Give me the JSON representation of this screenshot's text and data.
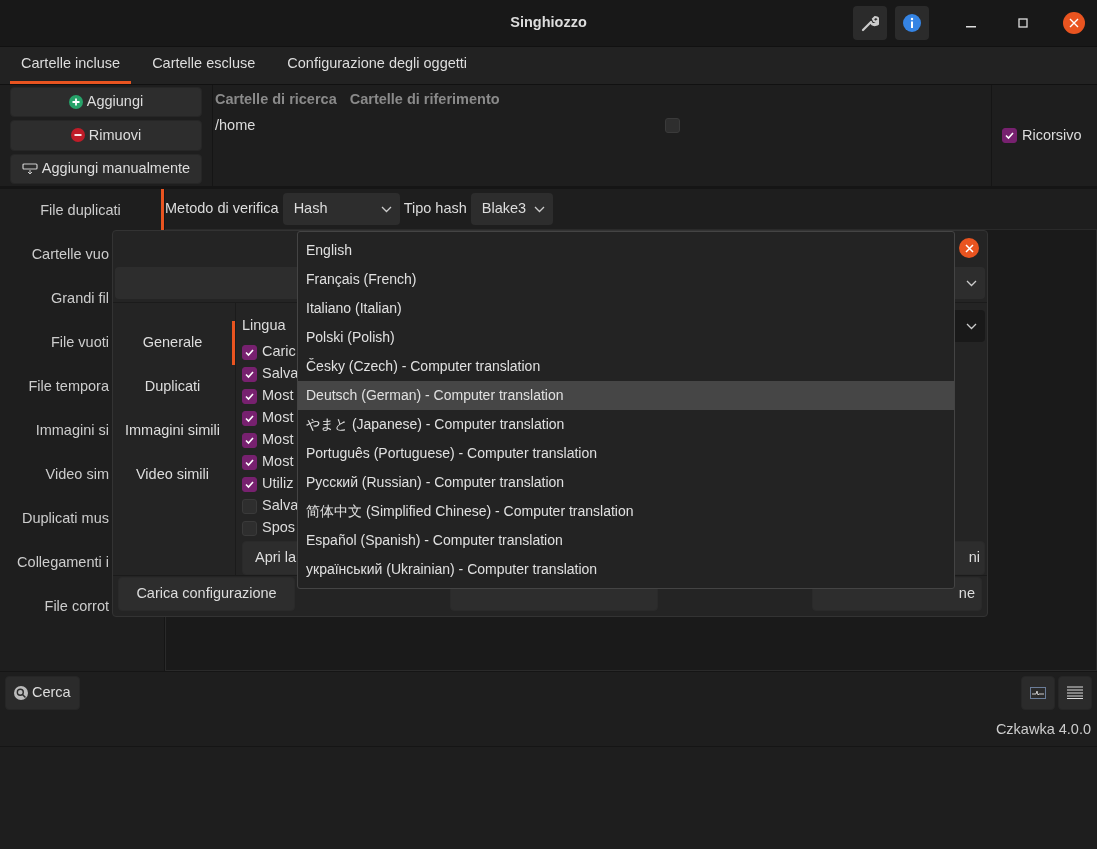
{
  "window": {
    "title": "Singhiozzo"
  },
  "tabs": [
    {
      "label": "Cartelle incluse",
      "selected": true
    },
    {
      "label": "Cartelle escluse",
      "selected": false
    },
    {
      "label": "Configurazione degli oggetti",
      "selected": false
    }
  ],
  "folder_buttons": [
    {
      "label": "Aggiungi",
      "kind": "add"
    },
    {
      "label": "Rimuovi",
      "kind": "remove"
    },
    {
      "label": "Aggiungi manualmente",
      "kind": "manual"
    }
  ],
  "folders_table": {
    "columns": [
      "Cartelle di ricerca",
      "Cartelle di riferimento"
    ],
    "rows": [
      {
        "path": "/home",
        "reference": false
      }
    ]
  },
  "recursive": {
    "label": "Ricorsivo",
    "checked": true
  },
  "verify": {
    "method_label": "Metodo di verifica",
    "method": "Hash",
    "hash_label": "Tipo hash",
    "hash": "Blake3"
  },
  "sidebar": {
    "items": [
      {
        "label": "File duplicati",
        "selected": true
      },
      {
        "label": "Cartelle vuo",
        "selected": false
      },
      {
        "label": "Grandi fil",
        "selected": false
      },
      {
        "label": "File vuoti",
        "selected": false
      },
      {
        "label": "File tempora",
        "selected": false
      },
      {
        "label": "Immagini si",
        "selected": false
      },
      {
        "label": "Video sim",
        "selected": false
      },
      {
        "label": "Duplicati mus",
        "selected": false
      },
      {
        "label": "Collegamenti i",
        "selected": false
      },
      {
        "label": "File corrot",
        "selected": false
      }
    ]
  },
  "search_button": "Cerca",
  "version": "Czkawka 4.0.0",
  "settings_dialog": {
    "tabs": [
      {
        "label": "Generale",
        "selected": true
      },
      {
        "label": "Duplicati",
        "selected": false
      },
      {
        "label": "Immagini simili",
        "selected": false
      },
      {
        "label": "Video simili",
        "selected": false
      }
    ],
    "language_label": "Lingua",
    "options": [
      {
        "label": "Caric",
        "checked": true
      },
      {
        "label": "Salva",
        "checked": true
      },
      {
        "label": "Most",
        "checked": true
      },
      {
        "label": "Most",
        "checked": true
      },
      {
        "label": "Most",
        "checked": true
      },
      {
        "label": "Most",
        "checked": true
      },
      {
        "label": "Utiliz",
        "checked": true
      },
      {
        "label": "Salva",
        "checked": false
      },
      {
        "label": "Spos",
        "checked": false
      }
    ],
    "open_button": "Apri la",
    "right_button": "ni",
    "bottom_buttons": [
      "Carica configurazione",
      "ne"
    ]
  },
  "language_dropdown": {
    "items": [
      {
        "label": "English",
        "selected": false
      },
      {
        "label": "Français (French)",
        "selected": false
      },
      {
        "label": "Italiano (Italian)",
        "selected": false
      },
      {
        "label": "Polski (Polish)",
        "selected": false
      },
      {
        "label": "Česky (Czech) - Computer translation",
        "selected": false
      },
      {
        "label": "Deutsch (German) - Computer translation",
        "selected": true
      },
      {
        "label": "やまと (Japanese) - Computer translation",
        "selected": false
      },
      {
        "label": "Português (Portuguese) - Computer translation",
        "selected": false
      },
      {
        "label": "Русский (Russian) - Computer translation",
        "selected": false
      },
      {
        "label": "简体中文 (Simplified Chinese) - Computer translation",
        "selected": false
      },
      {
        "label": "Español (Spanish) - Computer translation",
        "selected": false
      },
      {
        "label": "український (Ukrainian) - Computer translation",
        "selected": false
      }
    ]
  }
}
